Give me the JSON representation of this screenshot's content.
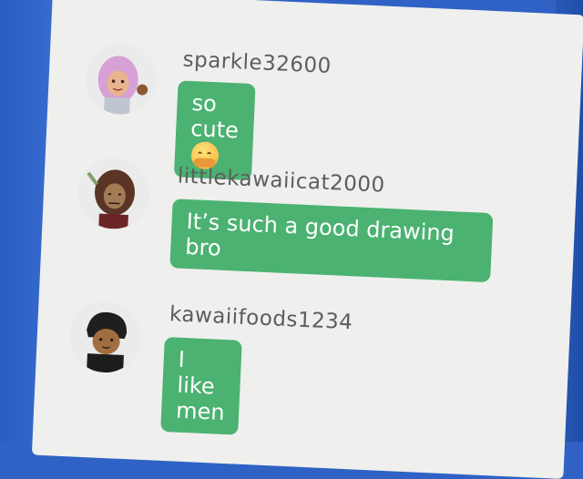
{
  "messages": [
    {
      "username": "sparkle32600",
      "text": "so cute",
      "emoji": "hugging-face-emoji"
    },
    {
      "username": "littlekawaiicat2000",
      "text": "It’s such a good drawing bro"
    },
    {
      "username": "kawaiifoods1234",
      "text": "I like men"
    }
  ],
  "colors": {
    "bubble": "#4bb271",
    "username": "#5d5d5d",
    "panel": "#efefee",
    "desktop": "#2f62c4"
  }
}
